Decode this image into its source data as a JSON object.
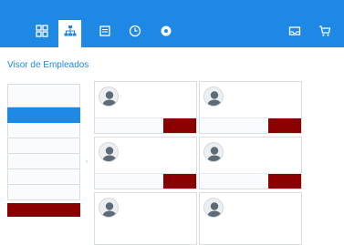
{
  "colors": {
    "header": "#1e88e5",
    "accent_red": "#8b0000",
    "active_tab_bg": "#ffffff"
  },
  "header": {
    "announcement": "",
    "nav_left": [
      {
        "icon": "grid-icon",
        "label": "",
        "active": false
      },
      {
        "icon": "org-chart-icon",
        "label": "",
        "active": true
      },
      {
        "icon": "calendar-icon",
        "label": "",
        "active": false
      },
      {
        "icon": "clock-icon",
        "label": "",
        "active": false
      },
      {
        "icon": "settings-circle-icon",
        "label": "",
        "active": false
      }
    ],
    "nav_right": [
      {
        "icon": "inbox-icon",
        "label": ""
      },
      {
        "icon": "cart-icon",
        "label": ""
      }
    ]
  },
  "page": {
    "title": "Visor de Empleados",
    "subtitle": ""
  },
  "sidebar": {
    "items": [
      {
        "label": ""
      },
      {
        "label": ""
      },
      {
        "label": ""
      },
      {
        "label": ""
      },
      {
        "label": ""
      },
      {
        "label": ""
      },
      {
        "label": ""
      },
      {
        "label": ""
      }
    ]
  },
  "employees": [
    {
      "name": "",
      "btn_a": "",
      "btn_b": ""
    },
    {
      "name": "",
      "btn_a": "",
      "btn_b": ""
    },
    {
      "name": "",
      "btn_a": "",
      "btn_b": ""
    },
    {
      "name": "",
      "btn_a": "",
      "btn_b": ""
    },
    {
      "name": "",
      "btn_a": "",
      "btn_b": ""
    },
    {
      "name": "",
      "btn_a": "",
      "btn_b": ""
    }
  ]
}
